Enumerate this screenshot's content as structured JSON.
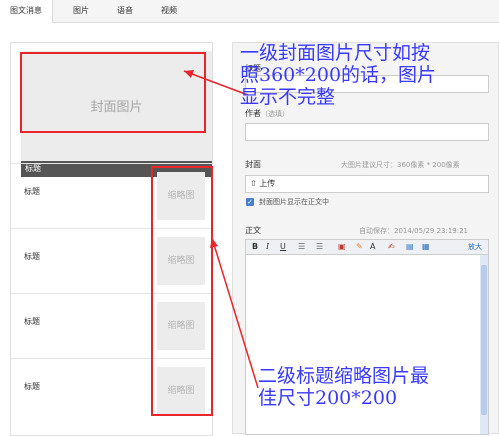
{
  "tabs": [
    {
      "label": "图文消息",
      "active": true
    },
    {
      "label": "图片",
      "active": false
    },
    {
      "label": "语音",
      "active": false
    },
    {
      "label": "视频",
      "active": false
    }
  ],
  "left": {
    "cover_placeholder": "封面图片",
    "cover_title": "标题",
    "items": [
      {
        "title": "标题",
        "thumb": "缩略图"
      },
      {
        "title": "标题",
        "thumb": "缩略图"
      },
      {
        "title": "标题",
        "thumb": "缩略图"
      },
      {
        "title": "标题",
        "thumb": "缩略图"
      }
    ]
  },
  "form": {
    "title_label": "标题",
    "author_label": "作者",
    "author_hint": "（选填）",
    "cover_label": "封面",
    "cover_hint": "大图片建议尺寸：360像素 * 200像素",
    "upload_label": "上传",
    "show_cover_label": "封面图片显示在正文中",
    "body_label": "正文",
    "autosave": "自动保存：2014/05/29 23:19:21",
    "toolbar": {
      "bold": "B",
      "italic": "I",
      "underline": "U",
      "font_color": "A",
      "fullscreen": "放大"
    }
  },
  "annotations": {
    "top_note": [
      "一级封面图片尺寸如按",
      "照360*200的话，图片",
      "显示不完整"
    ],
    "bottom_note": [
      "二级标题缩略图片最",
      "佳尺寸200*200"
    ],
    "color": "#e8252b",
    "text_color": "#3a3aff"
  }
}
